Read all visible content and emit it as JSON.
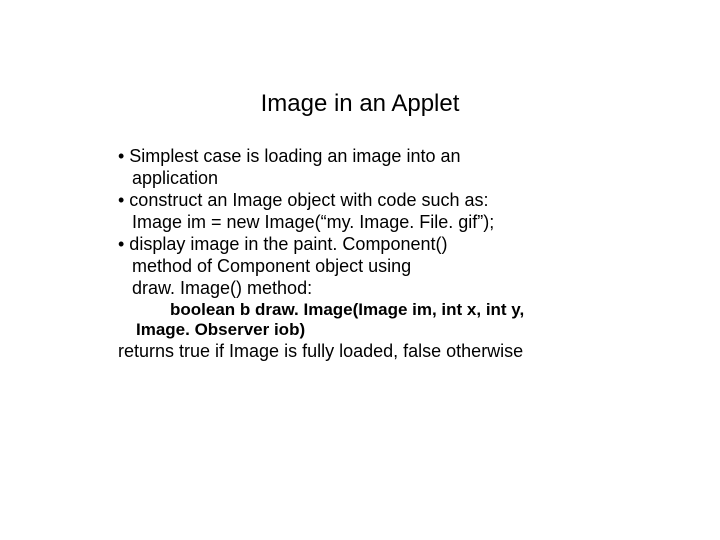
{
  "title": "Image in an Applet",
  "bullets": {
    "b1": "• Simplest case is loading an image into an",
    "b1c": "application",
    "b2": "• construct an Image object with code such as:",
    "b2c": "Image im = new Image(“my. Image. File. gif”);",
    "b3": "• display image in the paint. Component()",
    "b3c1": "method of Component object using",
    "b3c2": "draw. Image() method:"
  },
  "code": {
    "l1": "boolean b draw. Image(Image im, int x, int y,",
    "l2": "Image. Observer iob)"
  },
  "final": "returns true if Image is fully loaded, false otherwise"
}
